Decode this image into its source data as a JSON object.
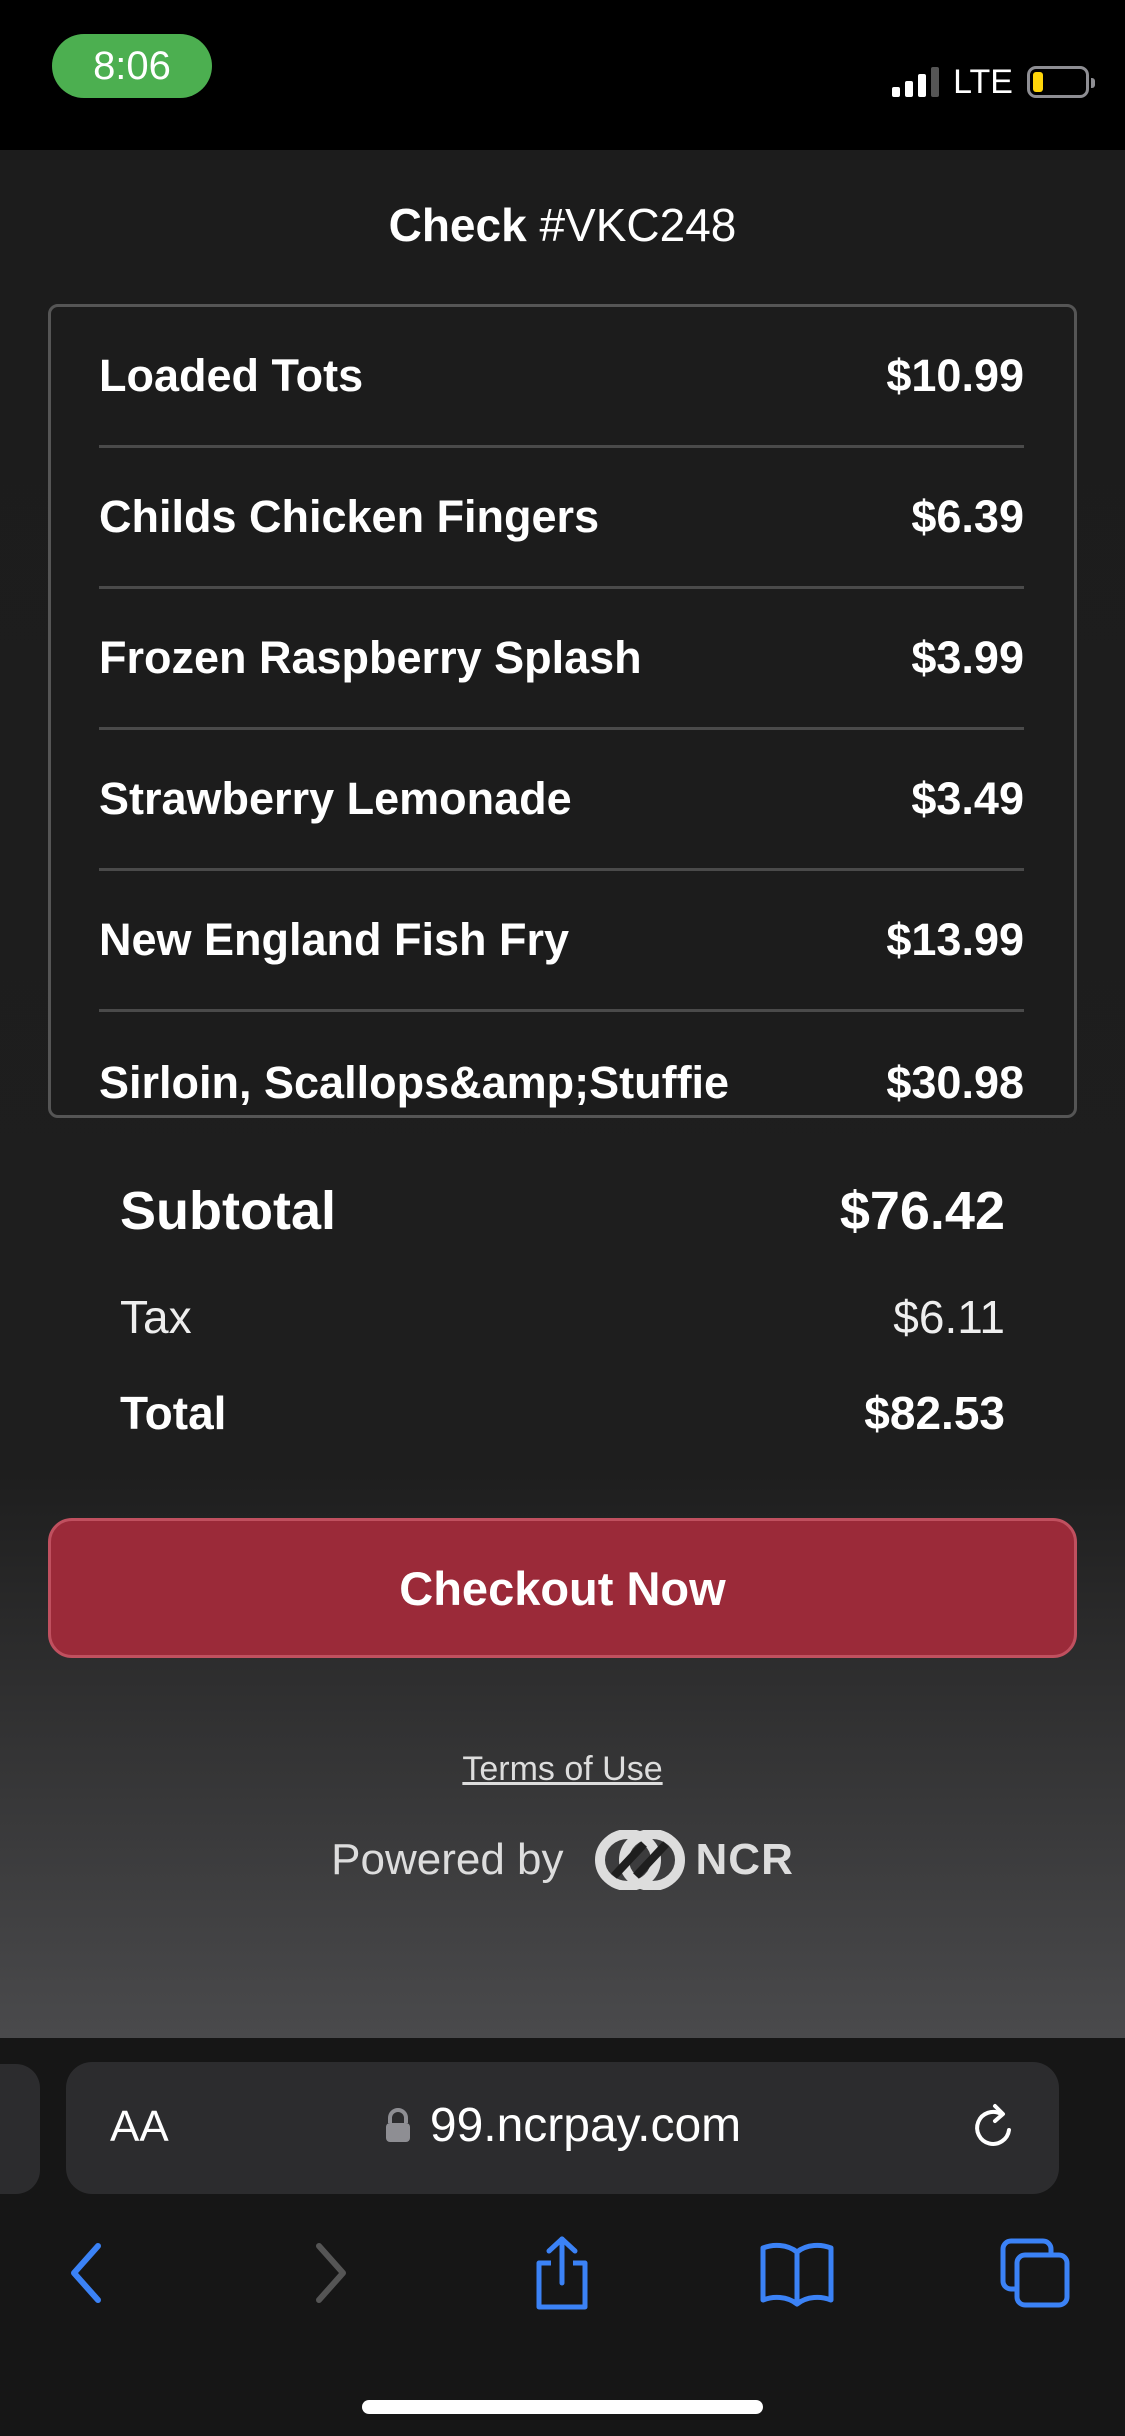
{
  "status_bar": {
    "time": "8:06",
    "network": "LTE",
    "accent_color": "#4caf50"
  },
  "header": {
    "check_label": "Check",
    "check_number": "#VKC248"
  },
  "items": [
    {
      "name": "Loaded Tots",
      "price": "$10.99"
    },
    {
      "name": "Childs Chicken Fingers",
      "price": "$6.39"
    },
    {
      "name": "Frozen Raspberry Splash",
      "price": "$3.99"
    },
    {
      "name": "Strawberry Lemonade",
      "price": "$3.49"
    },
    {
      "name": "New England Fish Fry",
      "price": "$13.99"
    },
    {
      "name": "Sirloin, Scallops&amp;Stuffie",
      "price": "$30.98"
    }
  ],
  "totals": {
    "subtotal_label": "Subtotal",
    "subtotal_value": "$76.42",
    "tax_label": "Tax",
    "tax_value": "$6.11",
    "total_label": "Total",
    "total_value": "$82.53"
  },
  "checkout": {
    "label": "Checkout Now",
    "color": "#9b2a39"
  },
  "footer": {
    "terms_label": "Terms of Use",
    "powered_by": "Powered by",
    "brand": "NCR"
  },
  "browser": {
    "text_size_label": "AA",
    "url": "99.ncrpay.com",
    "icons": [
      "back-icon",
      "forward-icon",
      "share-icon",
      "bookmarks-icon",
      "tabs-icon"
    ],
    "accent_color": "#3b82f6"
  }
}
